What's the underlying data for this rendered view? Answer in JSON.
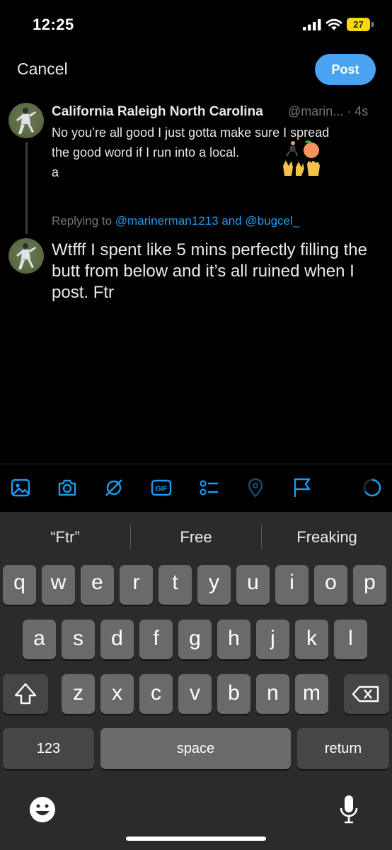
{
  "status_bar": {
    "time": "12:25",
    "battery": "27"
  },
  "header": {
    "cancel_label": "Cancel",
    "post_label": "Post"
  },
  "quoted_tweet": {
    "name": "California Raleigh North Carolina",
    "handle_time": "@marin... · 4s",
    "lines": [
      "No you’re all good I just gotta make sure I spread",
      "the good word if I run into a local.",
      "a"
    ]
  },
  "reply": {
    "replying_prefix": "Replying to",
    "mention_1": "@marinerman1213",
    "and_word": "and",
    "mention_2": "@bugcel_"
  },
  "compose": {
    "text": "Wtfff I spent like 5 mins perfectly filling the butt from below and it’s all ruined when I post. Ftr"
  },
  "toolbar": {
    "icons": [
      "image-icon",
      "camera-icon",
      "grok-icon",
      "gif-icon",
      "poll-icon",
      "location-icon",
      "flag-icon",
      "progress-ring-icon"
    ],
    "gif_label": "GIF"
  },
  "keyboard": {
    "suggestions": [
      "“Ftr”",
      "Free",
      "Freaking"
    ],
    "row1": [
      "q",
      "w",
      "e",
      "r",
      "t",
      "y",
      "u",
      "i",
      "o",
      "p"
    ],
    "row2": [
      "a",
      "s",
      "d",
      "f",
      "g",
      "h",
      "j",
      "k",
      "l"
    ],
    "row3": [
      "z",
      "x",
      "c",
      "v",
      "b",
      "n",
      "m"
    ],
    "numbers_label": "123",
    "space_label": "space",
    "return_label": "return"
  },
  "colors": {
    "accent": "#1d9bf0",
    "post_button": "#4aa3f0",
    "background": "#000000",
    "keyboard_bg": "#2b2b2d",
    "key_bg": "#6a6a6d"
  }
}
